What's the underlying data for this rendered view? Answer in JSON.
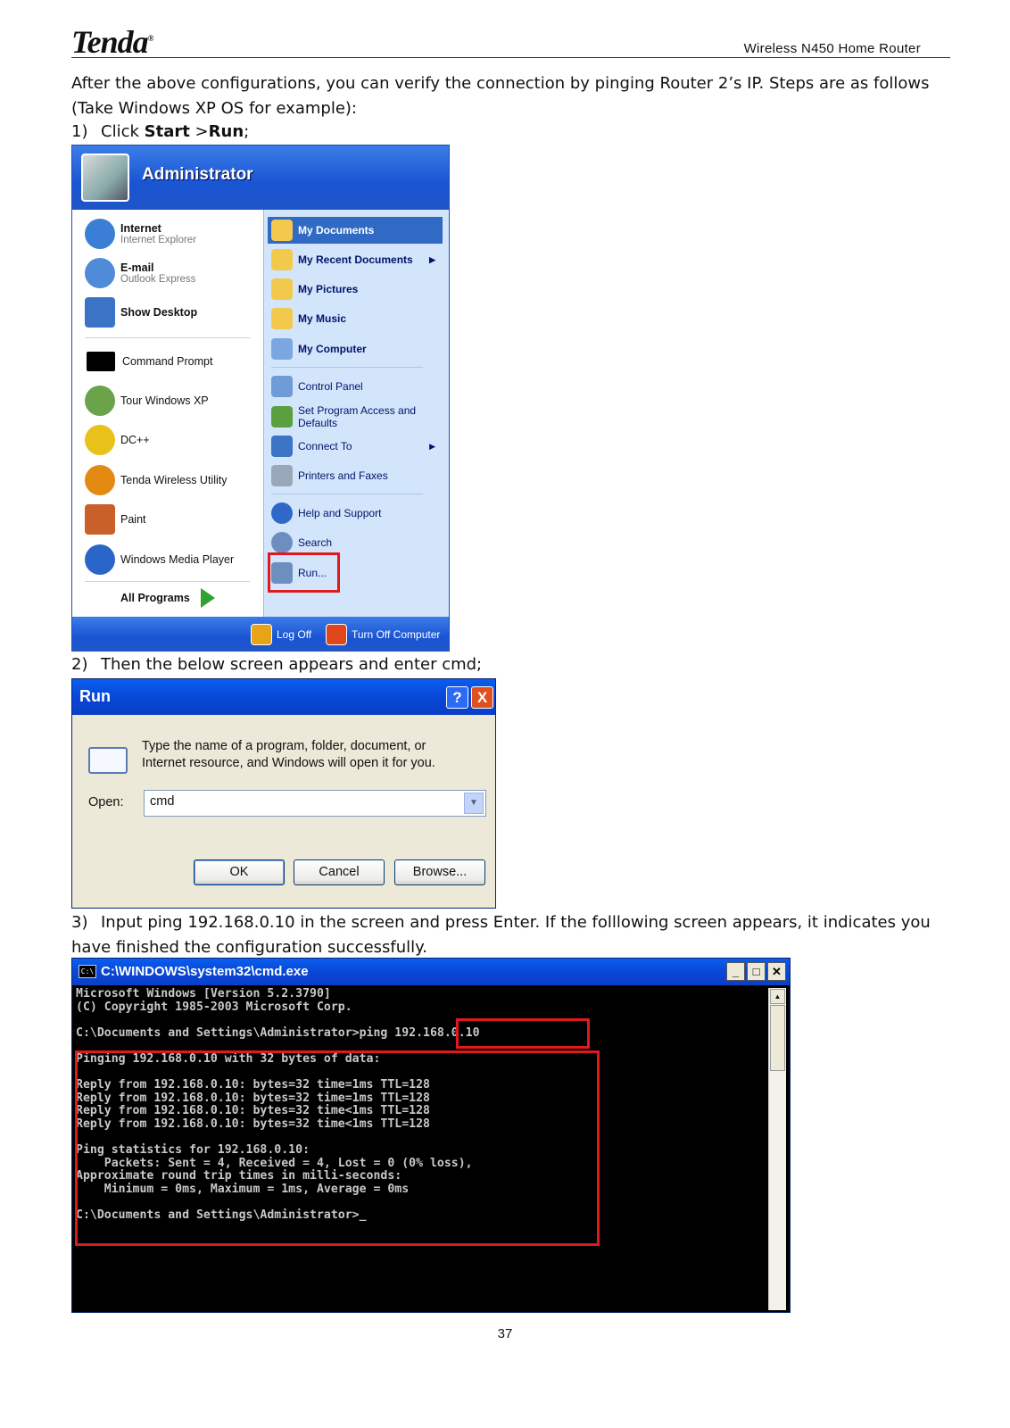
{
  "header": {
    "logo": "Tenda",
    "logo_mark": "®",
    "title": "Wireless N450 Home Router"
  },
  "intro": "After the above configurations, you can verify the connection by pinging Router 2’s IP. Steps are as follows (Take Windows XP OS for example):",
  "step1": {
    "num": "1)",
    "pre": "Click ",
    "b1": "Start",
    "mid": " >",
    "b2": "Run",
    "post": ";"
  },
  "step2": {
    "num": "2)",
    "text": "Then the below screen appears and enter cmd;"
  },
  "step3": {
    "num": "3)",
    "text": "Input ping 192.168.0.10 in the screen and press Enter. If the folllowing screen appears, it indicates you have finished the configuration successfully."
  },
  "start_menu": {
    "user": "Administrator",
    "pinned": [
      {
        "title": "Internet",
        "sub": "Internet Explorer",
        "color": "#3a7fd5"
      },
      {
        "title": "E-mail",
        "sub": "Outlook Express",
        "color": "#4f8bd8"
      },
      {
        "title": "Show Desktop",
        "sub": "",
        "color": "#3b73c6"
      }
    ],
    "recent": [
      {
        "label": "Command Prompt",
        "color": "#000000"
      },
      {
        "label": "Tour Windows XP",
        "color": "#6aa34a"
      },
      {
        "label": "DC++",
        "color": "#e8c21a"
      },
      {
        "label": "Tenda Wireless Utility",
        "color": "#e38a12"
      },
      {
        "label": "Paint",
        "color": "#c9602a"
      },
      {
        "label": "Windows Media Player",
        "color": "#2a66c8"
      }
    ],
    "all_programs": "All Programs",
    "places": [
      {
        "label": "My Documents",
        "bold": true,
        "color": "#f2c94c"
      },
      {
        "label": "My Recent Documents",
        "bold": true,
        "color": "#f2c94c"
      },
      {
        "label": "My Pictures",
        "bold": true,
        "color": "#f2c94c"
      },
      {
        "label": "My Music",
        "bold": true,
        "color": "#f2c94c"
      },
      {
        "label": "My Computer",
        "bold": true,
        "color": "#7aa7e0"
      },
      {
        "label": "Control Panel",
        "bold": false,
        "color": "#6f9bd6"
      },
      {
        "label": "Set Program Access and",
        "label2": "Defaults",
        "bold": false,
        "color": "#5aa03e"
      },
      {
        "label": "Connect To",
        "bold": false,
        "color": "#3d74c6"
      },
      {
        "label": "Printers and Faxes",
        "bold": false,
        "color": "#9aa7b8"
      },
      {
        "label": "Help and Support",
        "bold": false,
        "color": "#2f68c8"
      },
      {
        "label": "Search",
        "bold": false,
        "color": "#6d8fc0"
      },
      {
        "label": "Run...",
        "bold": false,
        "color": "#6d8fc0"
      }
    ],
    "log_off": "Log Off",
    "turn_off": "Turn Off Computer"
  },
  "run_dialog": {
    "title": "Run",
    "help": "?",
    "close": "X",
    "description_1": "Type the name of a program, folder, document, or",
    "description_2": "Internet resource, and Windows will open it for you.",
    "open_label": "Open:",
    "open_value": "cmd",
    "ok": "OK",
    "cancel": "Cancel",
    "browse": "Browse..."
  },
  "cmd_window": {
    "title": "C:\\WINDOWS\\system32\\cmd.exe",
    "icon_text": "C:\\",
    "lines": [
      "Microsoft Windows [Version 5.2.3790]",
      "(C) Copyright 1985-2003 Microsoft Corp.",
      "",
      "C:\\Documents and Settings\\Administrator>ping 192.168.0.10",
      "",
      "Pinging 192.168.0.10 with 32 bytes of data:",
      "",
      "Reply from 192.168.0.10: bytes=32 time=1ms TTL=128",
      "Reply from 192.168.0.10: bytes=32 time=1ms TTL=128",
      "Reply from 192.168.0.10: bytes=32 time<1ms TTL=128",
      "Reply from 192.168.0.10: bytes=32 time<1ms TTL=128",
      "",
      "Ping statistics for 192.168.0.10:",
      "    Packets: Sent = 4, Received = 4, Lost = 0 (0% loss),",
      "Approximate round trip times in milli-seconds:",
      "    Minimum = 0ms, Maximum = 1ms, Average = 0ms",
      "",
      "C:\\Documents and Settings\\Administrator>_"
    ]
  },
  "page_number": "37"
}
